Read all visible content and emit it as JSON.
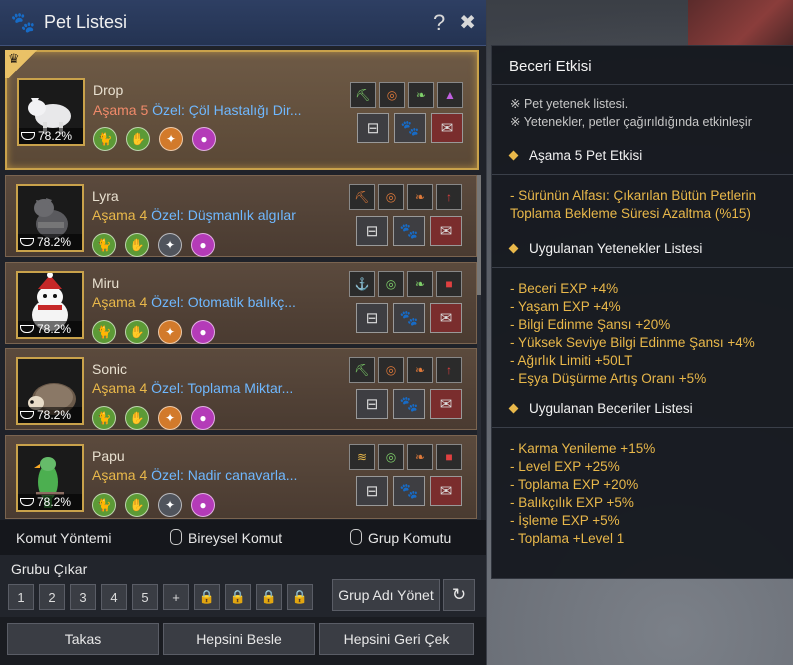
{
  "window": {
    "title": "Pet Listesi",
    "help": "?"
  },
  "pets": [
    {
      "name": "Drop",
      "stage_label": "Aşama",
      "stage_num": "5",
      "special": "Özel: Çöl Hastalığı Dir...",
      "hunger": "78.2%"
    },
    {
      "name": "Lyra",
      "stage_label": "Aşama",
      "stage_num": "4",
      "special": "Özel: Düşmanlık algılar",
      "hunger": "78.2%"
    },
    {
      "name": "Miru",
      "stage_label": "Aşama",
      "stage_num": "4",
      "special": "Özel: Otomatik balıkç...",
      "hunger": "78.2%"
    },
    {
      "name": "Sonic",
      "stage_label": "Aşama",
      "stage_num": "4",
      "special": "Özel: Toplama Miktar...",
      "hunger": "78.2%"
    },
    {
      "name": "Papu",
      "stage_label": "Aşama",
      "stage_num": "4",
      "special": "Özel: Nadir canavarla...",
      "hunger": "78.2%"
    }
  ],
  "command": {
    "method": "Komut Yöntemi",
    "individual": "Bireysel Komut",
    "group": "Grup Komutu"
  },
  "group": {
    "title": "Grubu Çıkar",
    "slots": [
      "1",
      "2",
      "3",
      "4",
      "5",
      "+"
    ],
    "manage": "Grup Adı Yönet"
  },
  "buttons": {
    "trade": "Takas",
    "feed_all": "Hepsini Besle",
    "recall_all": "Hepsini Geri Çek"
  },
  "tooltip": {
    "title": "Beceri Etkisi",
    "notes": [
      "※ Pet yetenek listesi.",
      "※ Yetenekler, petler çağırıldığında etkinleşir"
    ],
    "stage_header": "Aşama 5 Pet Etkisi",
    "stage_effect": [
      "- Sürünün Alfası: Çıkarılan Bütün Petlerin",
      "Toplama Bekleme Süresi Azaltma (%15)"
    ],
    "abilities_header": "Uygulanan Yetenekler Listesi",
    "abilities": [
      "- Beceri EXP +4%",
      "- Yaşam EXP +4%",
      "- Bilgi Edinme Şansı +20%",
      "- Yüksek Seviye Bilgi Edinme Şansı +4%",
      "- Ağırlık Limiti +50LT",
      "- Eşya Düşürme Artış Oranı +5%"
    ],
    "skills_header": "Uygulanan Beceriler Listesi",
    "skills": [
      "- Karma Yenileme +15%",
      "- Level EXP +25%",
      "- Toplama EXP +20%",
      "- Balıkçılık EXP +5%",
      "- İşleme EXP +5%",
      "- Toplama +Level 1"
    ]
  }
}
